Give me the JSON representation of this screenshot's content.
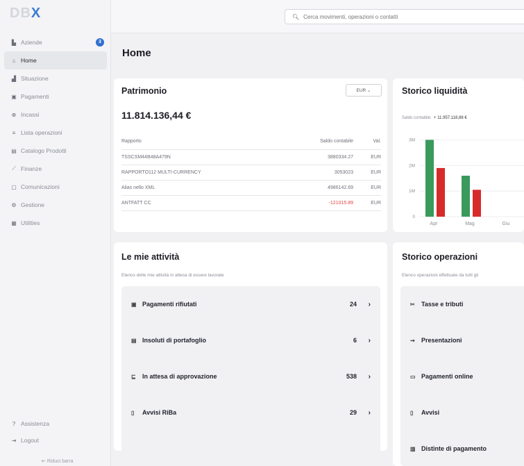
{
  "app": {
    "logo_a": "DB",
    "logo_b": "X"
  },
  "sidebar": {
    "items": [
      {
        "label": "Aziende",
        "icon": "building-icon",
        "glyph": "▙",
        "badge": "3"
      },
      {
        "label": "Home",
        "icon": "home-icon",
        "glyph": "⌂",
        "active": true
      },
      {
        "label": "Situazione",
        "icon": "chart-icon",
        "glyph": "▟"
      },
      {
        "label": "Pagamenti",
        "icon": "payments-icon",
        "glyph": "▣"
      },
      {
        "label": "Incassi",
        "icon": "incoming-icon",
        "glyph": "⊕"
      },
      {
        "label": "Lista operazioni",
        "icon": "list-icon",
        "glyph": "≡"
      },
      {
        "label": "Catalogo Prodotti",
        "icon": "catalog-icon",
        "glyph": "▤"
      },
      {
        "label": "Finanze",
        "icon": "finance-icon",
        "glyph": "⟋"
      },
      {
        "label": "Comunicazioni",
        "icon": "message-icon",
        "glyph": "▢"
      },
      {
        "label": "Gestione",
        "icon": "gear-icon",
        "glyph": "⚙"
      },
      {
        "label": "Utilities",
        "icon": "utilities-icon",
        "glyph": "▦"
      }
    ],
    "bottom": [
      {
        "label": "Assistenza",
        "icon": "help-icon",
        "glyph": "?"
      },
      {
        "label": "Logout",
        "icon": "logout-icon",
        "glyph": "⇥"
      }
    ],
    "collapse_label": "Riduci barra"
  },
  "search": {
    "placeholder": "Cerca movimenti, operazioni o contatti"
  },
  "page": {
    "title": "Home"
  },
  "patrimonio": {
    "title": "Patrimonio",
    "currency_select": "EUR",
    "total": "11.814.136,44 €",
    "columns": [
      "Rapporto",
      "Saldo contabile",
      "Val."
    ],
    "rows": [
      {
        "name": "TSSCSM44B48A479N",
        "saldo": "3880334.27",
        "val": "EUR",
        "neg": false
      },
      {
        "name": "RAPPORTO112 MULTI-CURRENCY",
        "saldo": "3053023",
        "val": "EUR",
        "neg": false
      },
      {
        "name": "Alias nello XML",
        "saldo": "4986142.69",
        "val": "EUR",
        "neg": false
      },
      {
        "name": "ANTFATT CC",
        "saldo": "-121015.89",
        "val": "EUR",
        "neg": true
      }
    ]
  },
  "liquidita": {
    "title": "Storico liquidità",
    "saldo_label": "Saldo contabile:",
    "saldo_value": "+ 11.957.118,88 €"
  },
  "chart_data": {
    "type": "bar",
    "categories": [
      "Apr",
      "Mag",
      "Giu"
    ],
    "series": [
      {
        "values": [
          3.0,
          1.6,
          null
        ],
        "color": "#3a9a5b"
      },
      {
        "values": [
          1.9,
          1.05,
          null
        ],
        "color": "#d62b2b"
      }
    ],
    "yticks": [
      "0",
      "1M",
      "2M",
      "3M"
    ],
    "ylim": [
      0,
      3.2
    ]
  },
  "attivita": {
    "title": "Le mie attività",
    "subtitle": "Elenco delle mie attività in attesa di essere lavorate",
    "items": [
      {
        "label": "Pagamenti rifiutati",
        "count": "24",
        "icon": "rejected-payment-icon",
        "glyph": "▣"
      },
      {
        "label": "Insoluti di portafoglio",
        "count": "6",
        "icon": "portfolio-icon",
        "glyph": "▤"
      },
      {
        "label": "In attesa di approvazione",
        "count": "538",
        "icon": "approval-icon",
        "glyph": "⊑"
      },
      {
        "label": "Avvisi RiBa",
        "count": "29",
        "icon": "notice-icon",
        "glyph": "▯"
      }
    ]
  },
  "storico": {
    "title": "Storico operazioni",
    "subtitle": "Elenco operazioni effettuate da tutti gli",
    "items": [
      {
        "label": "Tasse e tributi",
        "icon": "tax-icon",
        "glyph": "✂"
      },
      {
        "label": "Presentazioni",
        "icon": "presentation-icon",
        "glyph": "⇝"
      },
      {
        "label": "Pagamenti online",
        "icon": "online-payment-icon",
        "glyph": "▭"
      },
      {
        "label": "Avvisi",
        "icon": "notice-icon",
        "glyph": "▯"
      },
      {
        "label": "Distinte di pagamento",
        "icon": "payment-slip-icon",
        "glyph": "▥"
      }
    ]
  }
}
